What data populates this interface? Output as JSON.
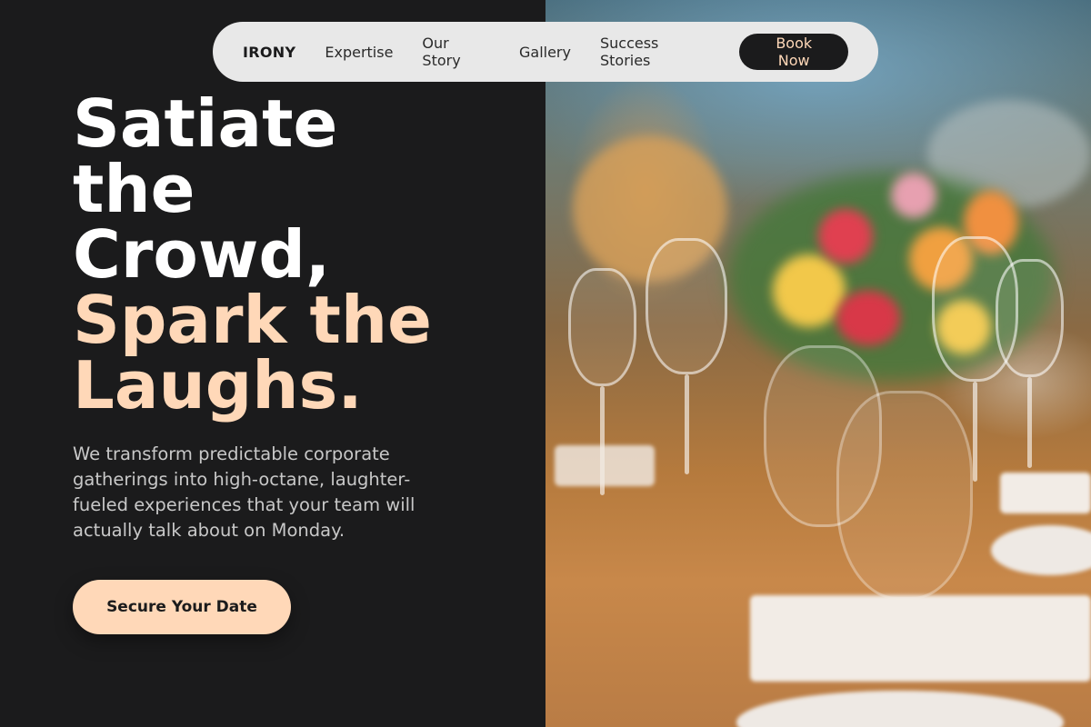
{
  "nav": {
    "brand": "IRONY",
    "links": [
      "Expertise",
      "Our Story",
      "Gallery",
      "Success Stories"
    ],
    "book_label": "Book Now"
  },
  "hero": {
    "title_lines": [
      "Satiate",
      "the",
      "Crowd,"
    ],
    "accent_lines": [
      "Spark the",
      "Laughs."
    ],
    "subtitle": "We transform predictable corporate gatherings into high-octane, laughter-fueled experiences that your team will actually talk about on Monday.",
    "cta_label": "Secure Your Date"
  },
  "colors": {
    "background": "#1b1b1c",
    "accent": "#ffd8b8",
    "nav_bg": "#e8e8e8"
  },
  "image": {
    "description_icon": "banquet-table-photo"
  }
}
